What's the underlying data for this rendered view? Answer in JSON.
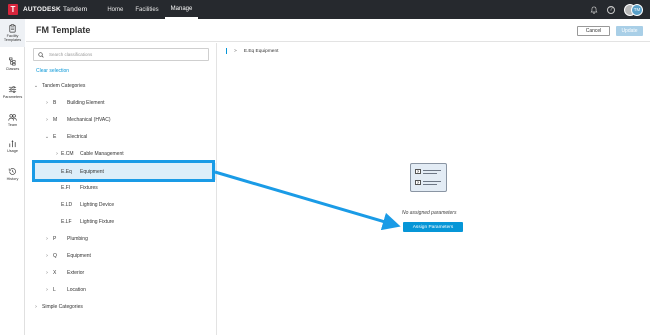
{
  "topbar": {
    "logo_letter": "T",
    "brand_bold": "AUTODESK",
    "brand_light": "Tandem",
    "nav": [
      {
        "label": "Home",
        "active": false
      },
      {
        "label": "Facilities",
        "active": false
      },
      {
        "label": "Manage",
        "active": true
      }
    ],
    "help_glyph": "?",
    "avatar_initials": "TM"
  },
  "rail": {
    "items": [
      {
        "label": "Facility\nTemplates",
        "icon": "clipboard-icon",
        "active": true
      },
      {
        "label": "Classes",
        "icon": "hierarchy-icon",
        "active": false
      },
      {
        "label": "Parameters",
        "icon": "sliders-icon",
        "active": false
      },
      {
        "label": "Team",
        "icon": "team-icon",
        "active": false
      },
      {
        "label": "Usage",
        "icon": "usage-icon",
        "active": false
      },
      {
        "label": "History",
        "icon": "history-icon",
        "active": false
      }
    ]
  },
  "header": {
    "title": "FM Template",
    "cancel_label": "Cancel",
    "update_label": "Update"
  },
  "panel": {
    "search_placeholder": "Search classifications",
    "clear_label": "Clear selection",
    "tree": [
      {
        "chev": "⌄",
        "code": "",
        "label": "Tandem Categories"
      },
      {
        "chev": "›",
        "code": "B",
        "label": "Building Element"
      },
      {
        "chev": "›",
        "code": "M",
        "label": "Mechanical (HVAC)"
      },
      {
        "chev": "⌄",
        "code": "E",
        "label": "Electrical"
      },
      {
        "chev": "›",
        "code": "E.CM",
        "label": "Cable Management"
      },
      {
        "chev": "",
        "code": "E.Eq",
        "label": "Equipment"
      },
      {
        "chev": "",
        "code": "E.FI",
        "label": "Fixtures"
      },
      {
        "chev": "",
        "code": "E.LD",
        "label": "Lighting Device"
      },
      {
        "chev": "",
        "code": "E.LF",
        "label": "Lighting Fixture"
      },
      {
        "chev": "›",
        "code": "P",
        "label": "Plumbing"
      },
      {
        "chev": "›",
        "code": "Q",
        "label": "Equipment"
      },
      {
        "chev": "›",
        "code": "X",
        "label": "Exterior"
      },
      {
        "chev": "›",
        "code": "L",
        "label": "Location"
      },
      {
        "chev": "›",
        "code": "",
        "label": "Simple Categories"
      }
    ]
  },
  "content": {
    "breadcrumb_chev": ">",
    "breadcrumb": "E.Eq Equipment",
    "empty_text": "No assigned parameters",
    "assign_label": "Assign Parameters",
    "empty_icon_marks": [
      "?",
      "?"
    ]
  },
  "colors": {
    "topbar": "#26292e",
    "accent": "#0696d7",
    "annotation": "#1a9be6",
    "selected_row": "#ddeef9"
  }
}
